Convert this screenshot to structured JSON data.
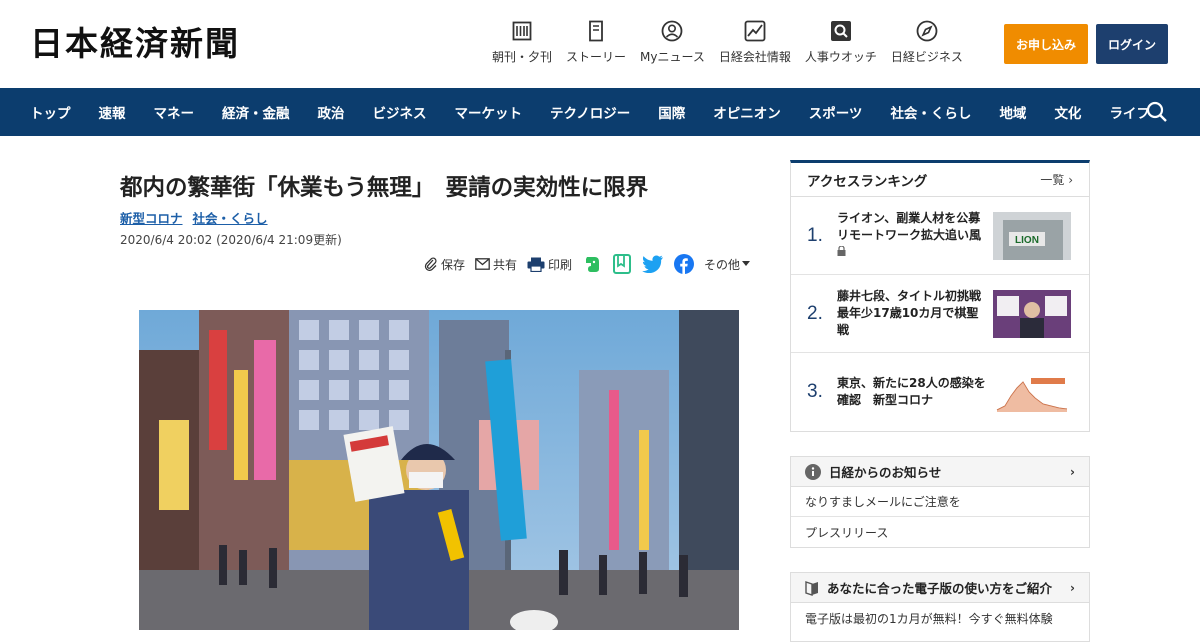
{
  "header": {
    "logo": "日本経済新聞",
    "nav": [
      {
        "label": "朝刊・夕刊",
        "icon": "newspaper-icon"
      },
      {
        "label": "ストーリー",
        "icon": "story-icon"
      },
      {
        "label": "Myニュース",
        "icon": "user-icon"
      },
      {
        "label": "日経会社情報",
        "icon": "chart-icon"
      },
      {
        "label": "人事ウオッチ",
        "icon": "search-icon"
      },
      {
        "label": "日経ビジネス",
        "icon": "compass-icon"
      }
    ],
    "subscribe_label": "お申し込み",
    "login_label": "ログイン"
  },
  "navbar": {
    "items": [
      "トップ",
      "速報",
      "マネー",
      "経済・金融",
      "政治",
      "ビジネス",
      "マーケット",
      "テクノロジー",
      "国際",
      "オピニオン",
      "スポーツ",
      "社会・くらし",
      "地域",
      "文化",
      "ライフ"
    ]
  },
  "article": {
    "headline": "都内の繁華街「休業もう無理」　要請の実効性に限界",
    "tags": [
      "新型コロナ",
      "社会・くらし"
    ],
    "date": "2020/6/4 20:02 (2020/6/4 21:09更新)",
    "share": {
      "save_label": "保存",
      "share_label": "共有",
      "print_label": "印刷",
      "more_label": "その他"
    }
  },
  "sidebar": {
    "ranking": {
      "title": "アクセスランキング",
      "more_label": "一覧",
      "items": [
        {
          "rank": "1.",
          "text": "ライオン、副業人材を公募　リモートワーク拡大追い風",
          "thumb_label": "LION"
        },
        {
          "rank": "2.",
          "text": "藤井七段、タイトル初挑戦　最年少17歳10カ月で棋聖戦"
        },
        {
          "rank": "3.",
          "text": "東京、新たに28人の感染を確認　新型コロナ"
        }
      ]
    },
    "notice": {
      "title": "日経からのお知らせ",
      "items": [
        "なりすましメールにご注意を",
        "プレスリリース"
      ]
    },
    "guide": {
      "title": "あなたに合った電子版の使い方をご紹介",
      "items": [
        "電子版は最初の1カ月が無料！今すぐ無料体験"
      ]
    }
  },
  "colors": {
    "navbar": "#0c3d6e",
    "subscribe": "#f08c00",
    "login": "#1d3f6e",
    "link": "#1d5fa8"
  }
}
